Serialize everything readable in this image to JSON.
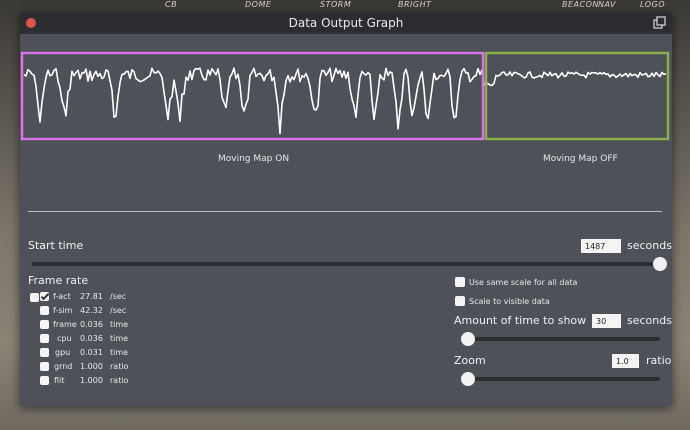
{
  "background_labels": [
    "CB",
    "DOME",
    "STORM",
    "BRIGHT",
    "BEACON",
    "NAV",
    "LOGO"
  ],
  "window": {
    "title": "Data Output Graph"
  },
  "graph": {
    "left_label": "Moving Map ON",
    "right_label": "Moving Map OFF",
    "left_box_color": "#d874e6",
    "right_box_color": "#8ab14d",
    "line_color": "#ffffff"
  },
  "start_time": {
    "label": "Start time",
    "value": "1487",
    "unit": "seconds",
    "slider_fraction": 1.0
  },
  "frame_rate": {
    "label": "Frame rate",
    "rows": [
      {
        "name": "f-act",
        "value": "27.81",
        "unit": "/sec",
        "checked": true
      },
      {
        "name": "f-sim",
        "value": "42.32",
        "unit": "/sec",
        "checked": false
      },
      {
        "name": "frame",
        "value": "0.036",
        "unit": "time",
        "checked": false
      },
      {
        "name": "cpu",
        "value": "0.036",
        "unit": "time",
        "checked": false
      },
      {
        "name": "gpu",
        "value": "0.031",
        "unit": "time",
        "checked": false
      },
      {
        "name": "grnd",
        "value": "1.000",
        "unit": "ratio",
        "checked": false
      },
      {
        "name": "flit",
        "value": "1.000",
        "unit": "ratio",
        "checked": false
      }
    ]
  },
  "options": {
    "same_scale": {
      "label": "Use same scale for all data",
      "checked": false
    },
    "visible_scale": {
      "label": "Scale to visible data",
      "checked": false
    }
  },
  "amount_time": {
    "label": "Amount of time to show",
    "value": "30",
    "unit": "seconds",
    "slider_fraction": 0.0
  },
  "zoom": {
    "label": "Zoom",
    "value": "1.0",
    "unit": "ratio",
    "slider_fraction": 0.0
  }
}
